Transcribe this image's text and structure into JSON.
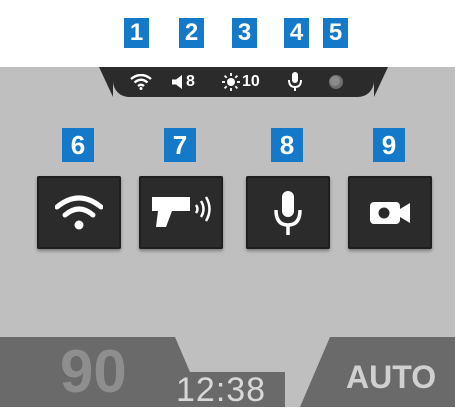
{
  "callouts": [
    "1",
    "2",
    "3",
    "4",
    "5",
    "6",
    "7",
    "8",
    "9"
  ],
  "status_bar": {
    "wifi_icon": "wifi-icon",
    "volume_icon": "speaker-icon",
    "volume_value": "8",
    "brightness_icon": "sun-icon",
    "brightness_value": "10",
    "mic_icon": "microphone-icon",
    "record_indicator_icon": "record-dot-icon"
  },
  "tiles": [
    {
      "name": "wifi-toggle",
      "icon": "wifi-icon"
    },
    {
      "name": "speed-camera-toggle",
      "icon": "speed-camera-icon"
    },
    {
      "name": "microphone-toggle",
      "icon": "microphone-icon"
    },
    {
      "name": "video-record-toggle",
      "icon": "video-camera-icon"
    }
  ],
  "bottom_bar": {
    "speed": "90",
    "time": "12:38",
    "mode": "AUTO"
  },
  "colors": {
    "callout": "#1479c9",
    "screen": "#bfbfbf",
    "dark": "#2b2b2b",
    "bottom_bar": "#6a6a6a"
  }
}
